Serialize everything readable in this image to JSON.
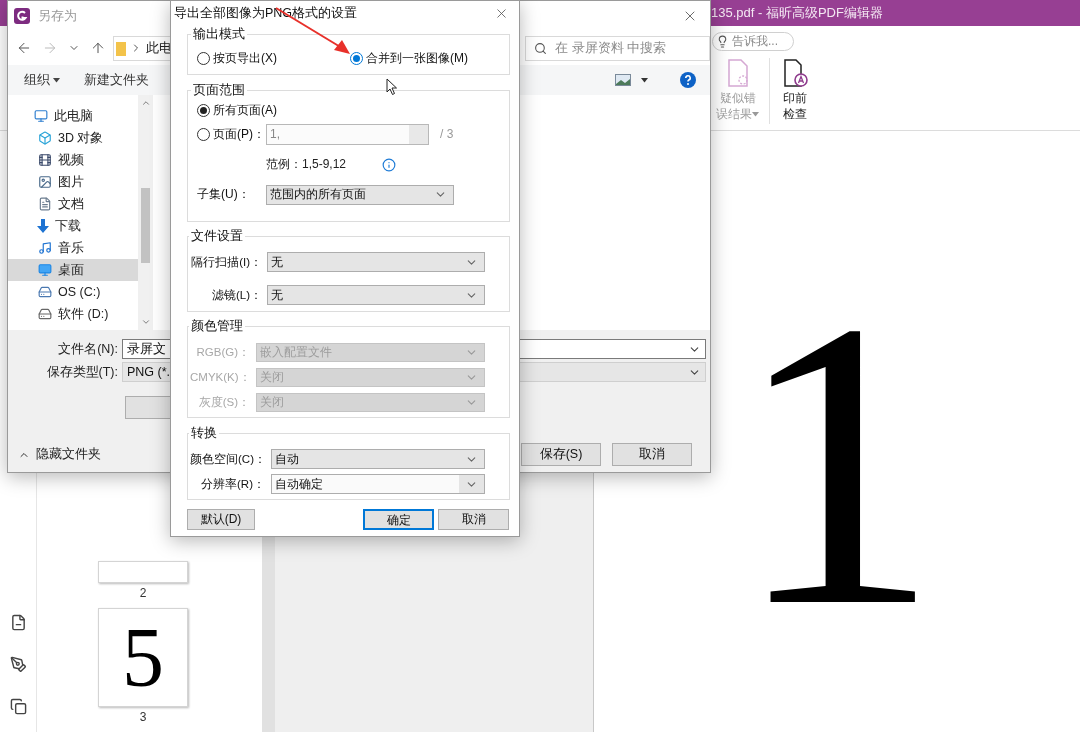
{
  "app": {
    "title": "135.pdf - 福昕高级PDF编辑器",
    "search_placeholder": "告诉我...",
    "ribbon": [
      {
        "kind": "scan",
        "lines": [
          "疑似错",
          "误结果"
        ],
        "disabled": true,
        "menu": true
      },
      {
        "kind": "preflight",
        "lines": [
          "印前",
          "检查"
        ],
        "disabled": false,
        "menu": false
      }
    ],
    "thumbnails": [
      {
        "label": "2"
      },
      {
        "label": "3",
        "content": "5"
      }
    ],
    "page_content": "1"
  },
  "save_as": {
    "title": "另存为",
    "address": "此电",
    "search_placeholder": "在 录屏资料 中搜索",
    "toolbar": [
      {
        "label": "组织",
        "menu": true
      },
      {
        "label": "新建文件夹",
        "menu": false
      }
    ],
    "tree": [
      {
        "label": "此电脑",
        "kind": "computer",
        "selected": false,
        "children": [
          {
            "label": "3D 对象",
            "kind": "objects",
            "selected": false
          },
          {
            "label": "视频",
            "kind": "videos",
            "selected": false
          },
          {
            "label": "图片",
            "kind": "pictures",
            "selected": false
          },
          {
            "label": "文档",
            "kind": "documents",
            "selected": false
          },
          {
            "label": "下载",
            "kind": "downloads",
            "selected": false
          },
          {
            "label": "音乐",
            "kind": "music",
            "selected": false
          },
          {
            "label": "桌面",
            "kind": "desktop",
            "selected": true
          },
          {
            "label": "OS (C:)",
            "kind": "system_drive",
            "selected": false
          },
          {
            "label": "软件 (D:)",
            "kind": "drive",
            "selected": false
          }
        ]
      }
    ],
    "fields": [
      {
        "label": "文件名(N):",
        "value": "录屏文",
        "kind": "input"
      },
      {
        "label": "保存类型(T):",
        "value": "PNG (*.",
        "kind": "select"
      }
    ],
    "hide_folders": "隐藏文件夹",
    "buttons": [
      "保存(S)",
      "取消"
    ]
  },
  "png_dialog": {
    "title": "导出全部图像为PNG格式的设置",
    "output_mode": {
      "legend": "输出模式",
      "options": [
        {
          "label": "按页导出(X)",
          "selected": false,
          "focused": false
        },
        {
          "label": "合并到一张图像(M)",
          "selected": true,
          "focused": true
        }
      ]
    },
    "page_range": {
      "legend": "页面范围",
      "options": [
        {
          "label": "所有页面(A)",
          "selected": true
        },
        {
          "label": "页面(P)：",
          "selected": false,
          "value": "1,",
          "total": "/ 3"
        }
      ],
      "example": "范例：1,5-9,12",
      "subset": {
        "label": "子集(U)：",
        "value": "范围内的所有页面"
      }
    },
    "groups": [
      {
        "legend": "文件设置",
        "disabled": false,
        "selects": [
          {
            "label": "隔行扫描(I)：",
            "value": "无",
            "editable": false
          },
          {
            "label": "滤镜(L)：",
            "value": "无",
            "editable": false
          }
        ]
      },
      {
        "legend": "颜色管理",
        "disabled": true,
        "selects": [
          {
            "label": "RGB(G)：",
            "value": "嵌入配置文件",
            "editable": false
          },
          {
            "label": "CMYK(K)：",
            "value": "关闭",
            "editable": false
          },
          {
            "label": "灰度(S)：",
            "value": "关闭",
            "editable": false
          }
        ]
      },
      {
        "legend": "转换",
        "disabled": false,
        "selects": [
          {
            "label": "颜色空间(C)：",
            "value": "自动",
            "editable": false
          },
          {
            "label": "分辨率(R)：",
            "value": "自动确定",
            "editable": true
          }
        ]
      }
    ],
    "buttons": [
      {
        "label": "默认(D)",
        "default": false
      },
      {
        "label": "确定",
        "default": true
      },
      {
        "label": "取消",
        "default": false
      }
    ]
  }
}
